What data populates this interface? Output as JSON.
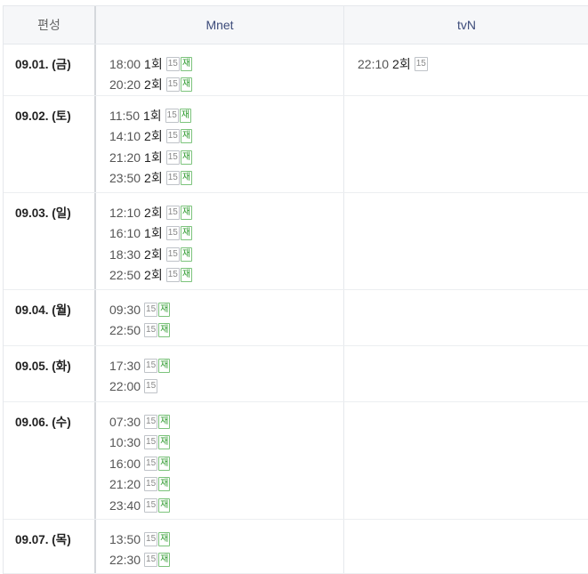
{
  "header": {
    "col_date": "편성",
    "col_mnet": "Mnet",
    "col_tvn": "tvN"
  },
  "days": [
    {
      "date": "09.01. (금)",
      "mnet": [
        {
          "time": "18:00",
          "episode": "1회",
          "rating": "15",
          "rerun": "재"
        },
        {
          "time": "20:20",
          "episode": "2회",
          "rating": "15",
          "rerun": "재"
        }
      ],
      "tvn": [
        {
          "time": "22:10",
          "episode": "2회",
          "rating": "15"
        }
      ]
    },
    {
      "date": "09.02. (토)",
      "mnet": [
        {
          "time": "11:50",
          "episode": "1회",
          "rating": "15",
          "rerun": "재"
        },
        {
          "time": "14:10",
          "episode": "2회",
          "rating": "15",
          "rerun": "재"
        },
        {
          "time": "21:20",
          "episode": "1회",
          "rating": "15",
          "rerun": "재"
        },
        {
          "time": "23:50",
          "episode": "2회",
          "rating": "15",
          "rerun": "재"
        }
      ],
      "tvn": []
    },
    {
      "date": "09.03. (일)",
      "mnet": [
        {
          "time": "12:10",
          "episode": "2회",
          "rating": "15",
          "rerun": "재"
        },
        {
          "time": "16:10",
          "episode": "1회",
          "rating": "15",
          "rerun": "재"
        },
        {
          "time": "18:30",
          "episode": "2회",
          "rating": "15",
          "rerun": "재"
        },
        {
          "time": "22:50",
          "episode": "2회",
          "rating": "15",
          "rerun": "재"
        }
      ],
      "tvn": []
    },
    {
      "date": "09.04. (월)",
      "mnet": [
        {
          "time": "09:30",
          "rating": "15",
          "rerun": "재"
        },
        {
          "time": "22:50",
          "rating": "15",
          "rerun": "재"
        }
      ],
      "tvn": []
    },
    {
      "date": "09.05. (화)",
      "mnet": [
        {
          "time": "17:30",
          "rating": "15",
          "rerun": "재"
        },
        {
          "time": "22:00",
          "rating": "15"
        }
      ],
      "tvn": []
    },
    {
      "date": "09.06. (수)",
      "mnet": [
        {
          "time": "07:30",
          "rating": "15",
          "rerun": "재"
        },
        {
          "time": "10:30",
          "rating": "15",
          "rerun": "재"
        },
        {
          "time": "16:00",
          "rating": "15",
          "rerun": "재"
        },
        {
          "time": "21:20",
          "rating": "15",
          "rerun": "재"
        },
        {
          "time": "23:40",
          "rating": "15",
          "rerun": "재"
        }
      ],
      "tvn": []
    },
    {
      "date": "09.07. (목)",
      "mnet": [
        {
          "time": "13:50",
          "rating": "15",
          "rerun": "재"
        },
        {
          "time": "22:30",
          "rating": "15",
          "rerun": "재"
        }
      ],
      "tvn": []
    }
  ]
}
